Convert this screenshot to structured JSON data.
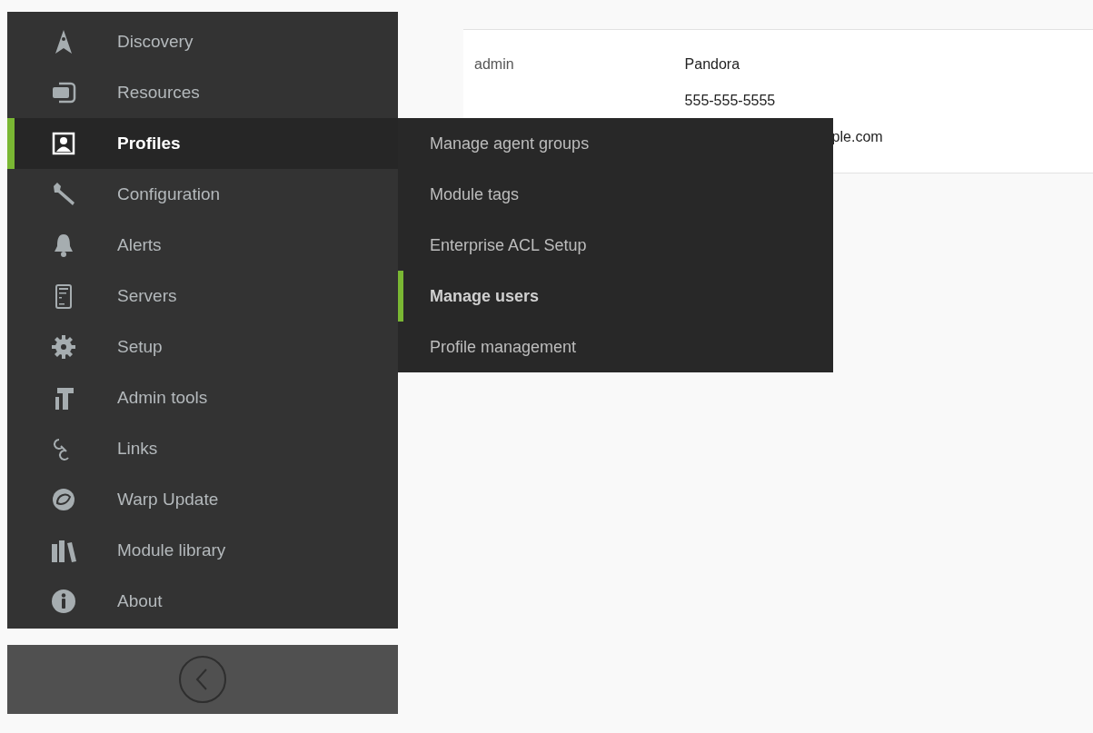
{
  "sidebar": {
    "items": [
      {
        "label": "Discovery",
        "selected": false
      },
      {
        "label": "Resources",
        "selected": false
      },
      {
        "label": "Profiles",
        "selected": true
      },
      {
        "label": "Configuration",
        "selected": false
      },
      {
        "label": "Alerts",
        "selected": false
      },
      {
        "label": "Servers",
        "selected": false
      },
      {
        "label": "Setup",
        "selected": false
      },
      {
        "label": "Admin tools",
        "selected": false
      },
      {
        "label": "Links",
        "selected": false
      },
      {
        "label": "Warp Update",
        "selected": false
      },
      {
        "label": "Module library",
        "selected": false
      },
      {
        "label": "About",
        "selected": false
      }
    ]
  },
  "submenu": {
    "items": [
      {
        "label": "Manage agent groups",
        "selected": false
      },
      {
        "label": "Module tags",
        "selected": false
      },
      {
        "label": "Enterprise ACL Setup",
        "selected": false
      },
      {
        "label": "Manage users",
        "selected": true
      },
      {
        "label": "Profile management",
        "selected": false
      }
    ]
  },
  "table": {
    "rows": [
      {
        "column_1": "admin",
        "column_2": [
          "Pandora",
          "555-555-5555",
          "ple.com"
        ]
      }
    ]
  }
}
